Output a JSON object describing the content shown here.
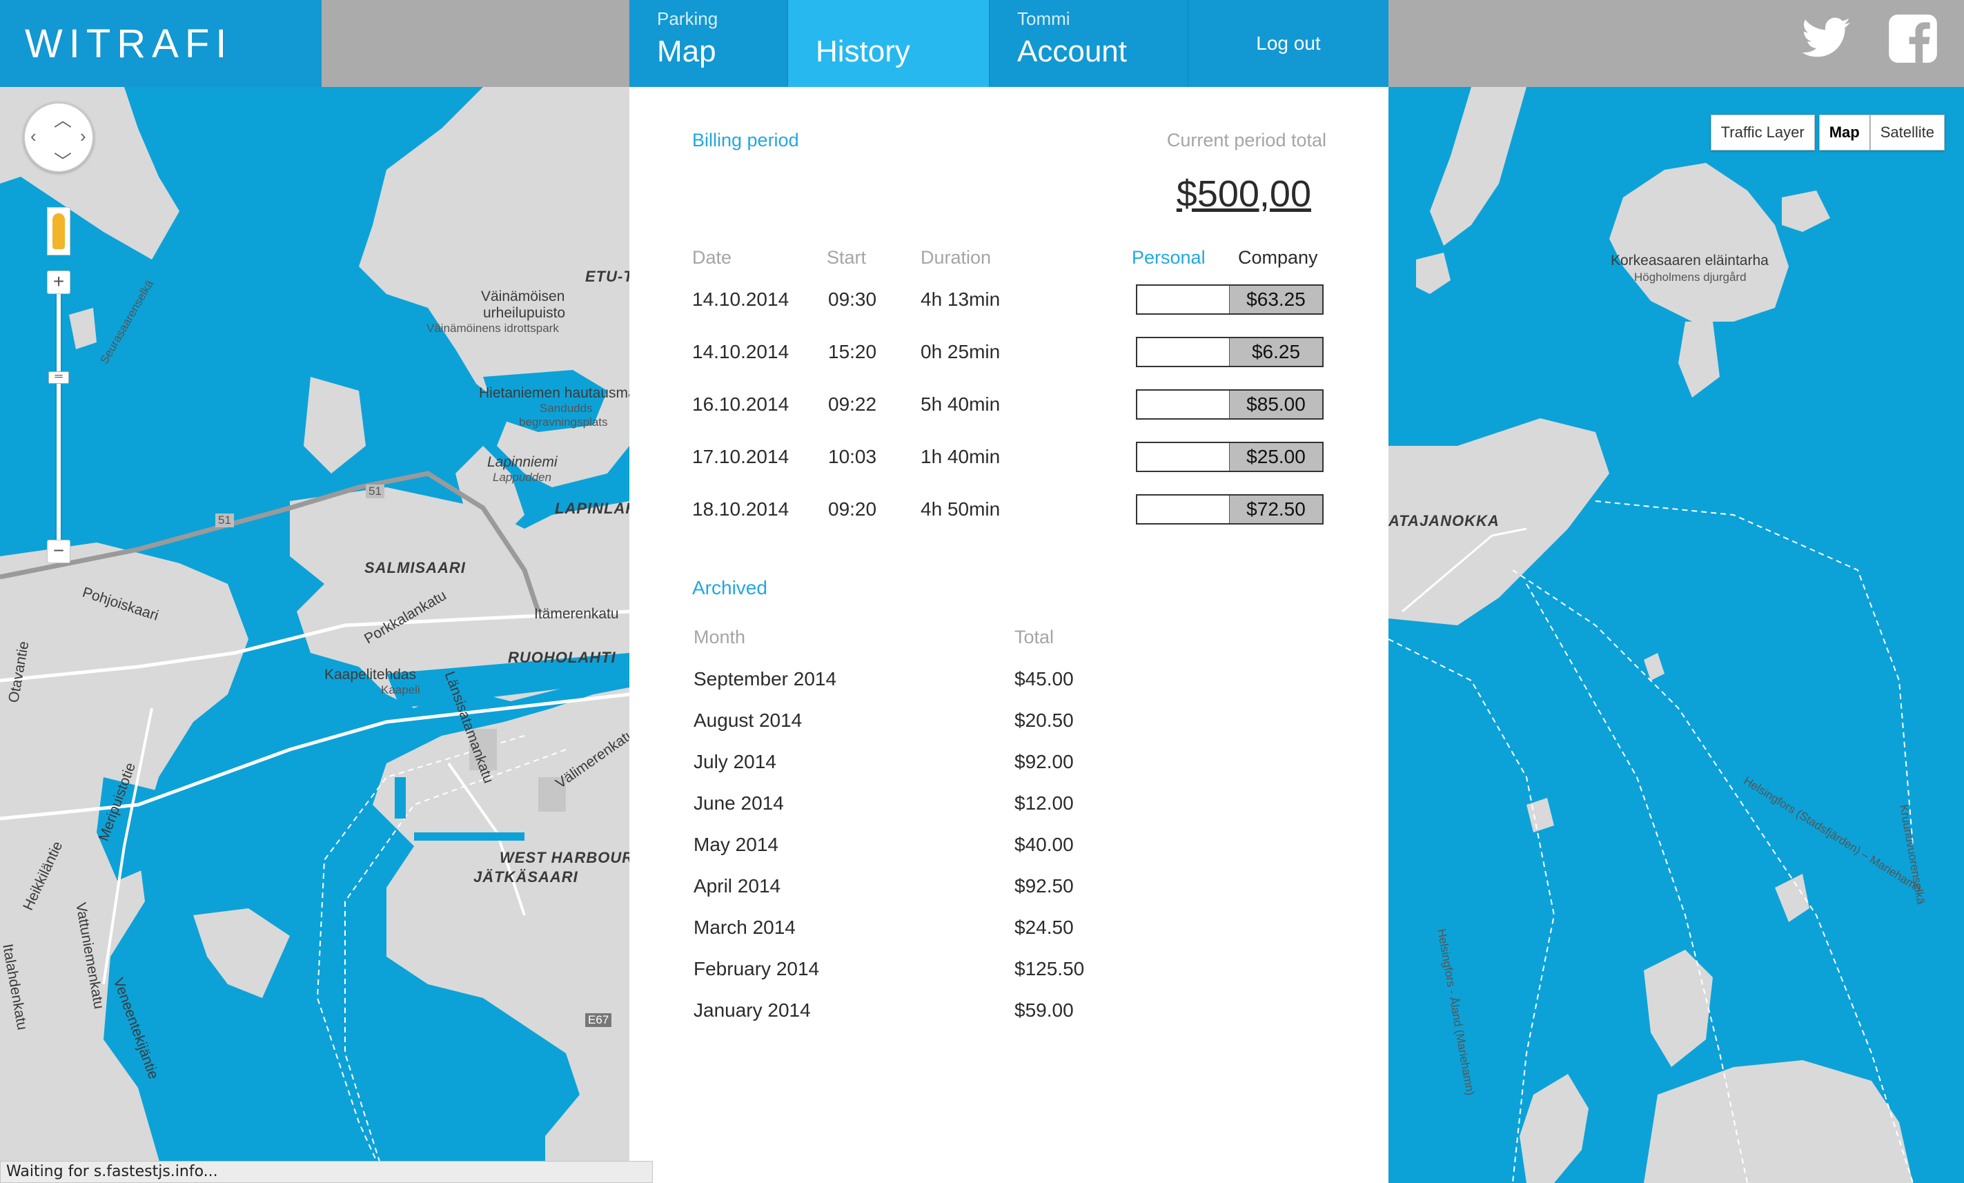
{
  "brand": {
    "logo_text": "WITRAFI"
  },
  "nav": {
    "map": {
      "sub": "Parking",
      "label": "Map"
    },
    "history": {
      "sub": "",
      "label": "History"
    },
    "account": {
      "sub": "Tommi",
      "label": "Account"
    },
    "logout": "Log out"
  },
  "social": {
    "twitter": "twitter-icon",
    "facebook": "facebook-icon"
  },
  "map_controls": {
    "map_type": [
      "Traffic Layer",
      "Map",
      "Satellite"
    ],
    "active_type": "Map",
    "zoom_in": "+",
    "zoom_out": "−"
  },
  "map_labels_left": {
    "seurasaarenselka": "Seurasaarenselkä",
    "vainamoisen": "Väinämöisen",
    "urheilupuisto": "urheilupuisto",
    "idrottspark": "Väinämöinens idrottspark",
    "etu": "ETU-T",
    "hietaniemen": "Hietaniemen hautausmaa",
    "sandudds": "Sandudds",
    "begravningsplats": "begravningsplats",
    "lapinniemi": "Lapinniemi",
    "lappudden": "Lappudden",
    "lapinlahti": "LAPINLAH",
    "salmisaari": "SALMISAARI",
    "pohjoiskaari": "Pohjoiskaari",
    "porkkalankatu": "Porkkalankatu",
    "itamerenkatu": "Itämerenkatu",
    "ruoholahti": "RUOHOLAHTI",
    "kaapelitehdas": "Kaapelitehdas",
    "kaapeli": "Kaapeli",
    "lansisatamankatu": "Länsisatamankatu",
    "valimerenkatu": "Välimerenkatu",
    "west_harbour": "WEST HARBOUR",
    "jatkasaari": "JÄTKÄSAARI",
    "meripuistotie": "Meripuistotie",
    "heikkilantie": "Heikkiläntie",
    "vattuniemenkatu": "Vattuniemenkatu",
    "vaneekijantie": "Veneentekijäntie",
    "italahdenkatu": "Italahdenkatu",
    "otavantie": "Otavantie",
    "road_51a": "51",
    "road_51b": "51",
    "e67": "E67"
  },
  "map_labels_right": {
    "korkeasaari": "Korkeasaaren eläintarha",
    "hogholmens": "Högholmens djurgård",
    "katajanokka": "ATAJANOKKA",
    "helsingfors_stat": "Helsingfors (Stadsfjärden) – Mariehamn",
    "helsingfors_aland": "Helsingfors - Åland (Mariehamn)",
    "kruunuvuorenselka": "Kruunuvuorenselkä"
  },
  "status_bar": "Waiting for s.fastestjs.info...",
  "history": {
    "billing_label": "Billing period",
    "period_total_label": "Current period total",
    "period_total": "$500,00",
    "headers": {
      "date": "Date",
      "start": "Start",
      "duration": "Duration",
      "personal": "Personal",
      "company": "Company"
    },
    "rows": [
      {
        "date": "14.10.2014",
        "start": "09:30",
        "duration": "4h 13min",
        "company": "$63.25"
      },
      {
        "date": "14.10.2014",
        "start": "15:20",
        "duration": "0h 25min",
        "company": "$6.25"
      },
      {
        "date": "16.10.2014",
        "start": "09:22",
        "duration": "5h 40min",
        "company": "$85.00"
      },
      {
        "date": "17.10.2014",
        "start": "10:03",
        "duration": "1h 40min",
        "company": "$25.00"
      },
      {
        "date": "18.10.2014",
        "start": "09:20",
        "duration": "4h 50min",
        "company": "$72.50"
      }
    ],
    "archived_label": "Archived",
    "archived_headers": {
      "month": "Month",
      "total": "Total"
    },
    "archived": [
      {
        "month": "September 2014",
        "total": "$45.00"
      },
      {
        "month": "August 2014",
        "total": "$20.50"
      },
      {
        "month": "July 2014",
        "total": "$92.00"
      },
      {
        "month": "June 2014",
        "total": "$12.00"
      },
      {
        "month": "May 2014",
        "total": "$40.00"
      },
      {
        "month": "April 2014",
        "total": "$92.50"
      },
      {
        "month": "March 2014",
        "total": "$24.50"
      },
      {
        "month": "February 2014",
        "total": "$125.50"
      },
      {
        "month": "January 2014",
        "total": "$59.00"
      }
    ]
  },
  "colors": {
    "brand_blue": "#1298d3",
    "active_tab": "#27b8ef",
    "water": "#0ca2d8",
    "land": "#d9d9d9",
    "accent_text": "#22a7df"
  }
}
